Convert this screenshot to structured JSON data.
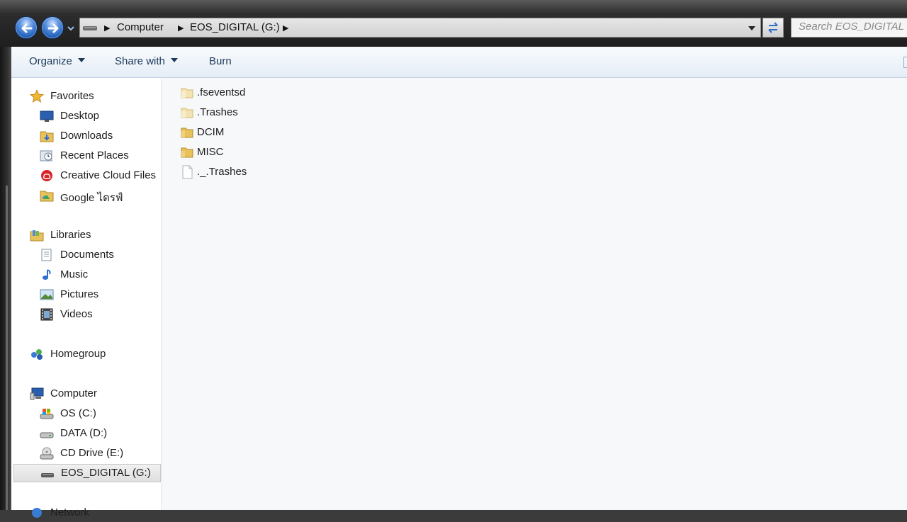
{
  "address": {
    "crumbs": [
      "Computer",
      "EOS_DIGITAL (G:)"
    ],
    "search_placeholder": "Search EOS_DIGITAL (G:)"
  },
  "toolbar": {
    "organize_label": "Organize",
    "share_label": "Share with",
    "burn_label": "Burn"
  },
  "nav": {
    "favorites": {
      "label": "Favorites",
      "items": [
        {
          "label": "Desktop",
          "icon": "desktop-icon"
        },
        {
          "label": "Downloads",
          "icon": "downloads-folder-icon"
        },
        {
          "label": "Recent Places",
          "icon": "recent-places-icon"
        },
        {
          "label": "Creative Cloud Files",
          "icon": "creative-cloud-icon"
        },
        {
          "label": "Google ไดรฟ์",
          "icon": "google-drive-folder-icon"
        }
      ]
    },
    "libraries": {
      "label": "Libraries",
      "items": [
        {
          "label": "Documents",
          "icon": "documents-icon"
        },
        {
          "label": "Music",
          "icon": "music-icon"
        },
        {
          "label": "Pictures",
          "icon": "pictures-icon"
        },
        {
          "label": "Videos",
          "icon": "videos-icon"
        }
      ]
    },
    "homegroup": {
      "label": "Homegroup",
      "icon": "homegroup-icon"
    },
    "computer": {
      "label": "Computer",
      "items": [
        {
          "label": "OS (C:)",
          "icon": "os-drive-icon"
        },
        {
          "label": "DATA (D:)",
          "icon": "hard-drive-icon"
        },
        {
          "label": "CD Drive (E:)",
          "icon": "cd-drive-icon"
        },
        {
          "label": "EOS_DIGITAL (G:)",
          "icon": "removable-drive-icon",
          "selected": true
        }
      ]
    },
    "network": {
      "label": "Network",
      "icon": "network-icon"
    }
  },
  "files": [
    {
      "name": ".fseventsd",
      "type": "folder",
      "icon": "folder-icon"
    },
    {
      "name": ".Trashes",
      "type": "folder",
      "icon": "folder-icon"
    },
    {
      "name": "DCIM",
      "type": "folder",
      "icon": "folder-icon"
    },
    {
      "name": "MISC",
      "type": "folder",
      "icon": "folder-icon"
    },
    {
      "name": "._.Trashes",
      "type": "file",
      "icon": "file-icon"
    }
  ],
  "colors": {
    "toolbar_text": "#1e395b",
    "folder": "#e8c15a",
    "nav_button": "#1f5db8"
  }
}
